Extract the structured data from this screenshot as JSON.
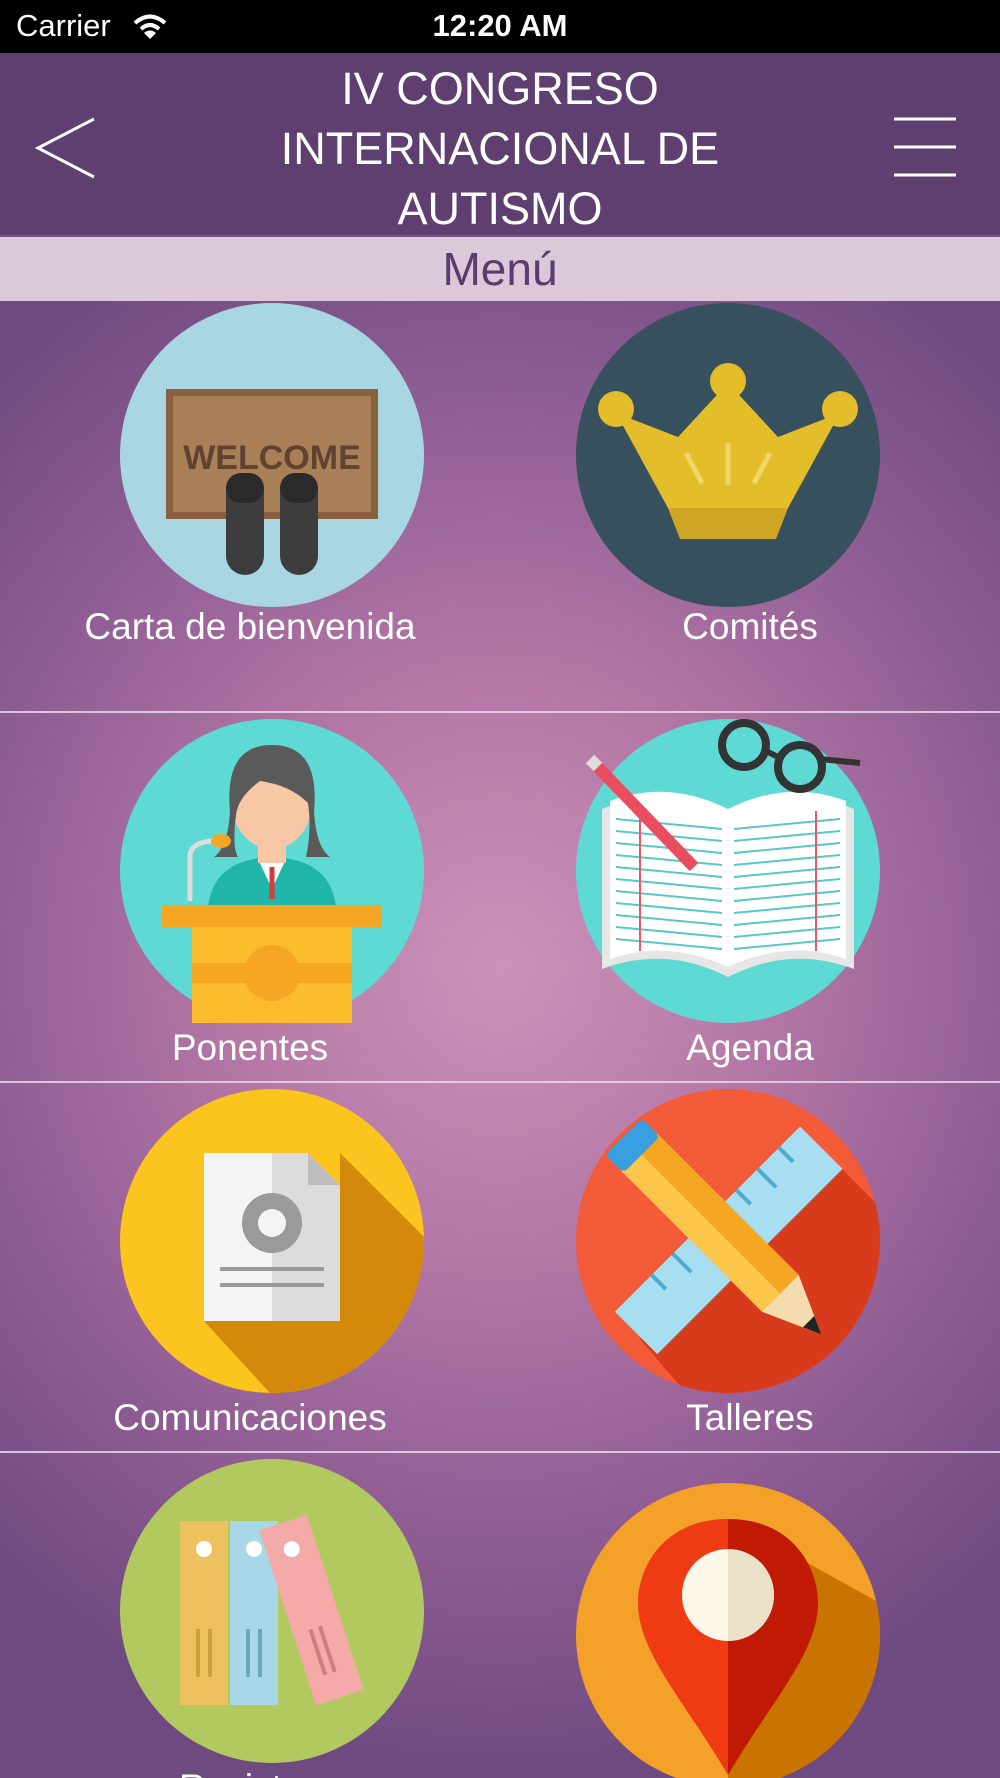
{
  "status_bar": {
    "carrier": "Carrier",
    "time": "12:20 AM"
  },
  "nav": {
    "title": "IV CONGRESO INTERNACIONAL DE AUTISMO"
  },
  "section": {
    "title": "Menú"
  },
  "menu_items": [
    {
      "label": "Carta de bienvenida",
      "icon": "welcome-mat-icon",
      "color": "#a8d6e2"
    },
    {
      "label": "Comités",
      "icon": "crown-icon",
      "color": "#37505e"
    },
    {
      "label": "Ponentes",
      "icon": "speaker-podium-icon",
      "color": "#5fd9d3"
    },
    {
      "label": "Agenda",
      "icon": "open-book-icon",
      "color": "#5fd9d3"
    },
    {
      "label": "Comunicaciones",
      "icon": "document-icon",
      "color": "#fbc41e"
    },
    {
      "label": "Talleres",
      "icon": "ruler-pencil-icon",
      "color": "#f25a38"
    },
    {
      "label": "Revistas",
      "icon": "binders-icon",
      "color": "#b2c960"
    },
    {
      "label": "",
      "icon": "map-pin-icon",
      "color": "#f4a12a"
    }
  ]
}
